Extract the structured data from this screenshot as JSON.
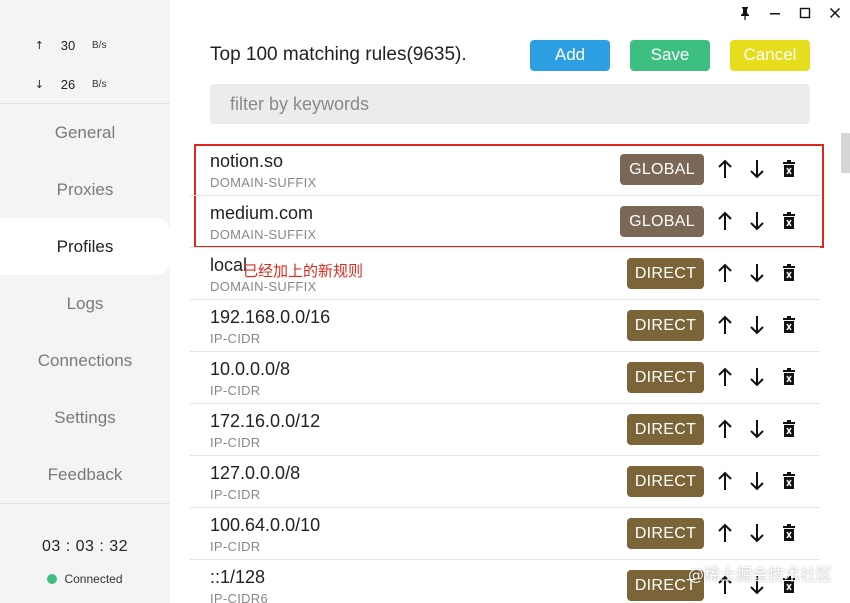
{
  "window": {
    "pin_icon": "pin-icon",
    "minimize_icon": "minimize-icon",
    "maximize_icon": "maximize-icon",
    "close_icon": "close-icon"
  },
  "traffic": {
    "up_arrow": "↑",
    "up_value": "30",
    "up_unit": "B/s",
    "down_arrow": "↓",
    "down_value": "26",
    "down_unit": "B/s"
  },
  "nav": {
    "items": [
      {
        "label": "General",
        "active": false
      },
      {
        "label": "Proxies",
        "active": false
      },
      {
        "label": "Profiles",
        "active": true
      },
      {
        "label": "Logs",
        "active": false
      },
      {
        "label": "Connections",
        "active": false
      },
      {
        "label": "Settings",
        "active": false
      },
      {
        "label": "Feedback",
        "active": false
      }
    ]
  },
  "status": {
    "time": "03 : 03 : 32",
    "connection": "Connected",
    "connection_color": "#3fbf7f"
  },
  "header": {
    "title": "Top 100 matching rules(9635).",
    "add_label": "Add",
    "save_label": "Save",
    "cancel_label": "Cancel",
    "add_color": "#2f9fe4",
    "save_color": "#3cbf80",
    "cancel_color": "#e6de1c"
  },
  "filter": {
    "placeholder": "filter by keywords"
  },
  "rules": [
    {
      "name": "notion.so",
      "type": "DOMAIN-SUFFIX",
      "policy": "GLOBAL"
    },
    {
      "name": "medium.com",
      "type": "DOMAIN-SUFFIX",
      "policy": "GLOBAL"
    },
    {
      "name": "local",
      "type": "DOMAIN-SUFFIX",
      "policy": "DIRECT"
    },
    {
      "name": "192.168.0.0/16",
      "type": "IP-CIDR",
      "policy": "DIRECT"
    },
    {
      "name": "10.0.0.0/8",
      "type": "IP-CIDR",
      "policy": "DIRECT"
    },
    {
      "name": "172.16.0.0/12",
      "type": "IP-CIDR",
      "policy": "DIRECT"
    },
    {
      "name": "127.0.0.0/8",
      "type": "IP-CIDR",
      "policy": "DIRECT"
    },
    {
      "name": "100.64.0.0/10",
      "type": "IP-CIDR",
      "policy": "DIRECT"
    },
    {
      "name": "::1/128",
      "type": "IP-CIDR6",
      "policy": "DIRECT"
    }
  ],
  "annotation": {
    "text": "已经加上的新规则",
    "color": "#e0271c"
  },
  "watermark": "@稀土掘金技术社区"
}
